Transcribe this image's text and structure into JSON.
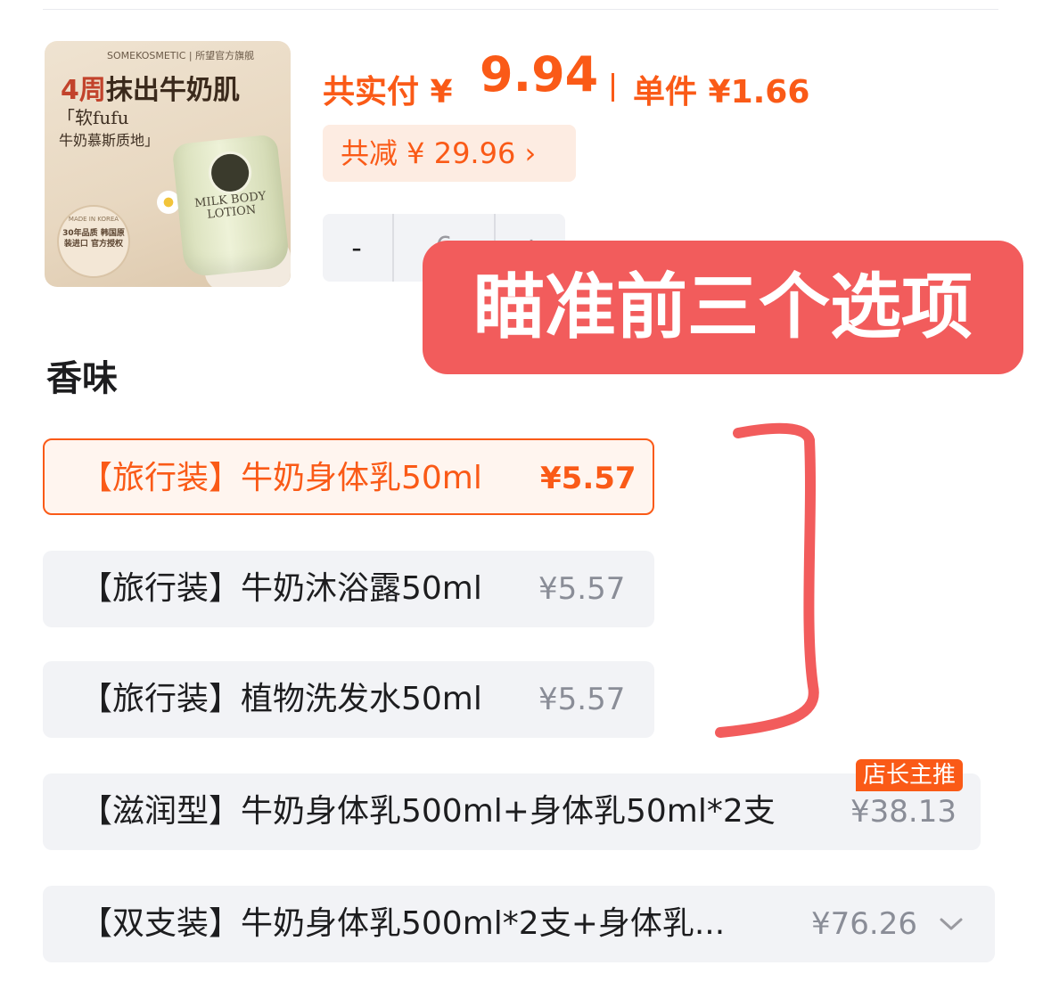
{
  "product": {
    "thumbnail": {
      "brand_text": "SOMEKOSMETIC | 所望官方旗舰",
      "headline_num": "4周",
      "headline_text": "抹出牛奶肌",
      "tagline_1": "「软fufu",
      "tagline_2": "牛奶慕斯质地」",
      "tube_label": "MILK BODY LOTION",
      "badge_top": "MADE IN KOREA",
      "badge_text": "30年品质 韩国原装进口 官方授权"
    }
  },
  "price": {
    "total_label": "共实付 ¥",
    "total_value": "9.94",
    "unit_label": "单件 ¥1.66",
    "discount_label": "共减 ¥ 29.96 ›",
    "accent_color": "#fa5a17"
  },
  "quantity": {
    "minus": "-",
    "value": "6",
    "plus": "+"
  },
  "annotation": {
    "callout": "瞄准前三个选项",
    "color": "#f25c5c"
  },
  "section": {
    "title": "香味"
  },
  "options": [
    {
      "name": "【旅行装】牛奶身体乳50ml",
      "price": "¥5.57",
      "selected": true
    },
    {
      "name": "【旅行装】牛奶沐浴露50ml",
      "price": "¥5.57",
      "selected": false
    },
    {
      "name": "【旅行装】植物洗发水50ml",
      "price": "¥5.57",
      "selected": false
    },
    {
      "name": "【滋润型】牛奶身体乳500ml+身体乳50ml*2支",
      "price": "¥38.13",
      "selected": false,
      "tag": "店长主推"
    },
    {
      "name": "【双支装】牛奶身体乳500ml*2支+身体乳...",
      "price": "¥76.26",
      "selected": false
    }
  ]
}
